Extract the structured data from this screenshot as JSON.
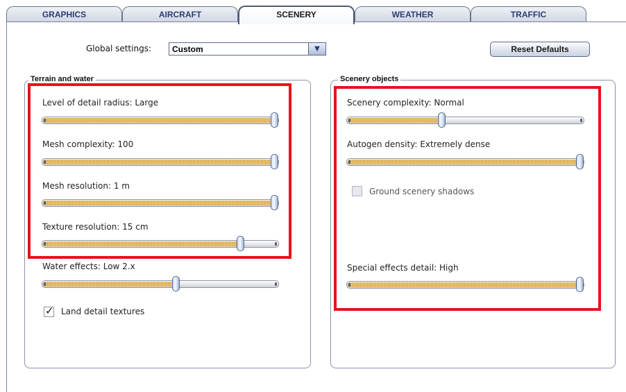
{
  "tabs": [
    {
      "label": "GRAPHICS",
      "active": false
    },
    {
      "label": "AIRCRAFT",
      "active": false
    },
    {
      "label": "SCENERY",
      "active": true
    },
    {
      "label": "WEATHER",
      "active": false
    },
    {
      "label": "TRAFFIC",
      "active": false
    }
  ],
  "global_settings": {
    "label": "Global settings:",
    "value": "Custom"
  },
  "reset_button": {
    "label": "Reset Defaults"
  },
  "terrain": {
    "title": "Terrain and water",
    "sliders": [
      {
        "label": "Level of detail radius: Large",
        "level": 1.0
      },
      {
        "label": "Mesh complexity: 100",
        "level": 1.0
      },
      {
        "label": "Mesh resolution: 1 m",
        "level": 1.0
      },
      {
        "label": "Texture resolution: 15 cm",
        "level": 0.85
      },
      {
        "label": "Water effects: Low 2.x",
        "level": 0.57
      }
    ],
    "checkbox": {
      "label": "Land detail textures",
      "checked": true
    }
  },
  "scenery": {
    "title": "Scenery objects",
    "sliders": [
      {
        "label": "Scenery complexity: Normal",
        "level": 0.4
      },
      {
        "label": "Autogen density: Extremely dense",
        "level": 1.0
      },
      {
        "label": "Special effects detail: High",
        "level": 1.0
      }
    ],
    "checkbox": {
      "label": "Ground scenery shadows",
      "checked": false,
      "disabled": true
    }
  },
  "colors": {
    "highlight": "#e8121b",
    "fill": "#d9a446",
    "accent": "#2a3d70"
  }
}
